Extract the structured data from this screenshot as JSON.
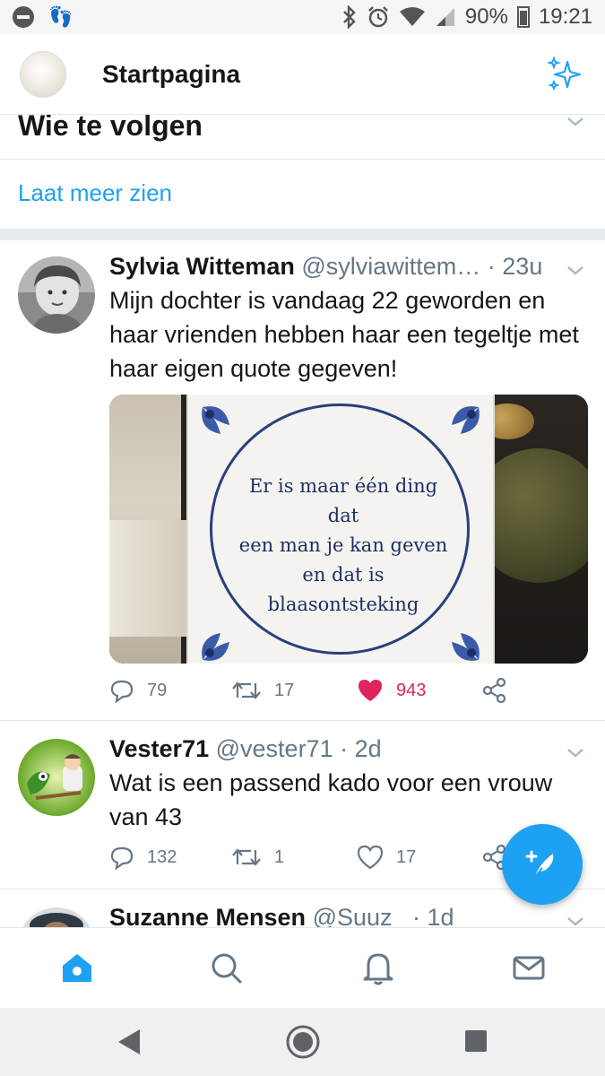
{
  "status_bar": {
    "battery": "90%",
    "time": "19:21",
    "icons": [
      "do-not-disturb-icon",
      "steps-icon",
      "bluetooth-icon",
      "alarm-icon",
      "wifi-icon",
      "signal-icon",
      "battery-icon"
    ]
  },
  "header": {
    "title": "Startpagina",
    "sparkle_icon": "sparkle-icon"
  },
  "who_to_follow": {
    "title": "Wie te volgen",
    "show_more": "Laat meer zien"
  },
  "tweets": [
    {
      "name": "Sylvia Witteman",
      "handle": "@sylviawittem…",
      "time": "· 23u",
      "text": "Mijn dochter is vandaag 22 geworden en haar vrienden hebben haar een tegeltje met haar eigen quote gegeven!",
      "media_quote": [
        "Er is maar één ding dat",
        "een man je kan geven",
        "en dat is blaasontsteking"
      ],
      "replies": "79",
      "retweets": "17",
      "likes": "943",
      "liked": true
    },
    {
      "name": "Vester71",
      "handle": "@vester71",
      "time": "· 2d",
      "text": "Wat is een passend kado voor een vrouw van 43",
      "replies": "132",
      "retweets": "1",
      "likes": "17",
      "liked": false
    },
    {
      "name": "Suzanne Mensen",
      "handle": "@Suuz_",
      "time": "· 1d"
    }
  ],
  "bottom_nav": [
    "home-icon",
    "search-icon",
    "notifications-icon",
    "messages-icon"
  ],
  "colors": {
    "accent": "#1da1f2",
    "like": "#e0245e",
    "muted": "#657786"
  }
}
